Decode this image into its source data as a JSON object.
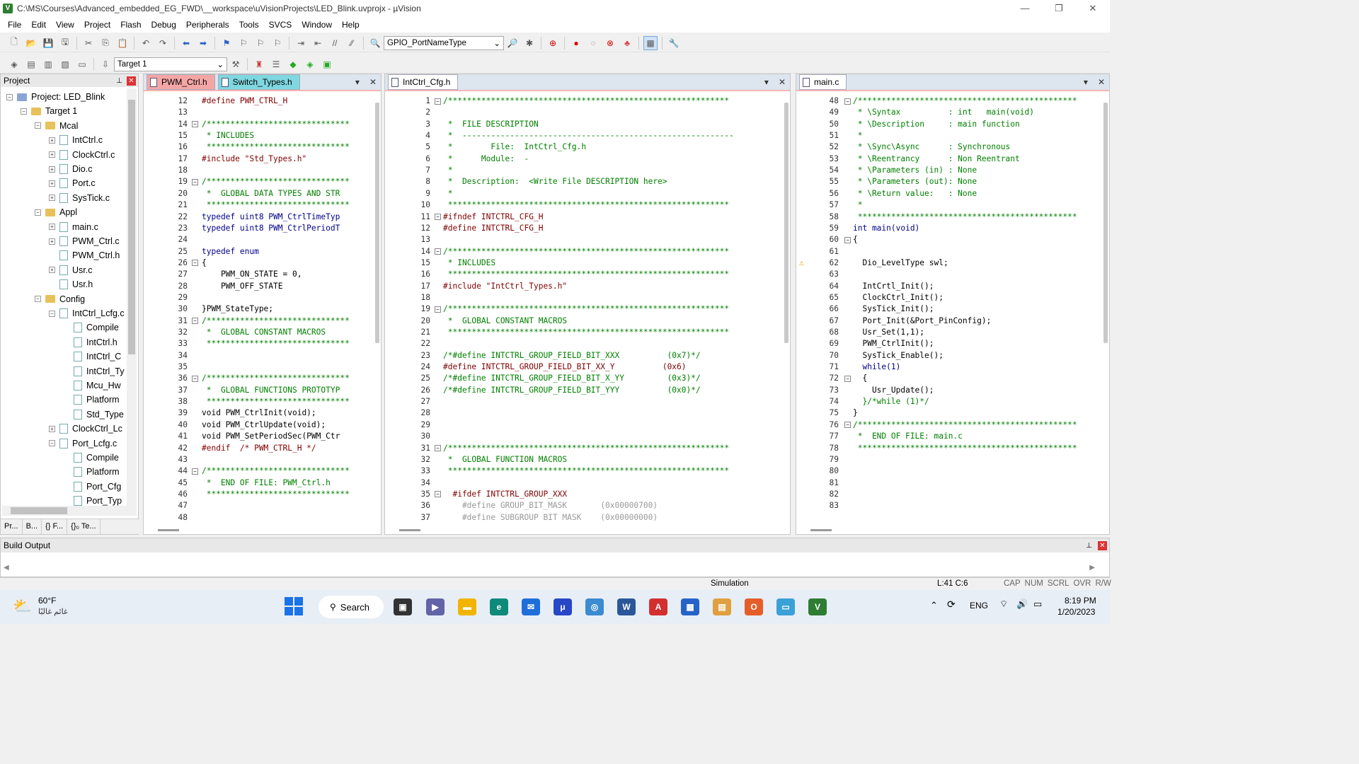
{
  "window": {
    "title": "C:\\MS\\Courses\\Advanced_embedded_EG_FWD\\__workspace\\uVisionProjects\\LED_Blink.uvprojx - µVision",
    "minimize": "—",
    "maximize": "❐",
    "close": "✕"
  },
  "menu": [
    "File",
    "Edit",
    "View",
    "Project",
    "Flash",
    "Debug",
    "Peripherals",
    "Tools",
    "SVCS",
    "Window",
    "Help"
  ],
  "toolbar1": {
    "type_combo": "GPIO_PortNameType"
  },
  "toolbar2": {
    "target_combo": "Target 1"
  },
  "project_panel": {
    "title": "Project",
    "tree": [
      {
        "label": "Project: LED_Blink",
        "level": 0,
        "kind": "project",
        "exp": "−"
      },
      {
        "label": "Target 1",
        "level": 1,
        "kind": "folder",
        "exp": "−"
      },
      {
        "label": "Mcal",
        "level": 2,
        "kind": "folder",
        "exp": "−"
      },
      {
        "label": "IntCtrl.c",
        "level": 3,
        "kind": "file",
        "exp": "+"
      },
      {
        "label": "ClockCtrl.c",
        "level": 3,
        "kind": "file",
        "exp": "+"
      },
      {
        "label": "Dio.c",
        "level": 3,
        "kind": "file",
        "exp": "+"
      },
      {
        "label": "Port.c",
        "level": 3,
        "kind": "file",
        "exp": "+"
      },
      {
        "label": "SysTick.c",
        "level": 3,
        "kind": "file",
        "exp": "+"
      },
      {
        "label": "Appl",
        "level": 2,
        "kind": "folder",
        "exp": "−"
      },
      {
        "label": "main.c",
        "level": 3,
        "kind": "file",
        "exp": "+"
      },
      {
        "label": "PWM_Ctrl.c",
        "level": 3,
        "kind": "file",
        "exp": "+"
      },
      {
        "label": "PWM_Ctrl.h",
        "level": 3,
        "kind": "file",
        "exp": ""
      },
      {
        "label": "Usr.c",
        "level": 3,
        "kind": "file",
        "exp": "+"
      },
      {
        "label": "Usr.h",
        "level": 3,
        "kind": "file",
        "exp": ""
      },
      {
        "label": "Config",
        "level": 2,
        "kind": "folder",
        "exp": "−"
      },
      {
        "label": "IntCtrl_Lcfg.c",
        "level": 3,
        "kind": "file",
        "exp": "−"
      },
      {
        "label": "Compile",
        "level": 4,
        "kind": "file",
        "exp": ""
      },
      {
        "label": "IntCtrl.h",
        "level": 4,
        "kind": "file",
        "exp": ""
      },
      {
        "label": "IntCtrl_C",
        "level": 4,
        "kind": "file",
        "exp": ""
      },
      {
        "label": "IntCtrl_Ty",
        "level": 4,
        "kind": "file",
        "exp": ""
      },
      {
        "label": "Mcu_Hw",
        "level": 4,
        "kind": "file",
        "exp": ""
      },
      {
        "label": "Platform",
        "level": 4,
        "kind": "file",
        "exp": ""
      },
      {
        "label": "Std_Type",
        "level": 4,
        "kind": "file",
        "exp": ""
      },
      {
        "label": "ClockCtrl_Lc",
        "level": 3,
        "kind": "file",
        "exp": "+"
      },
      {
        "label": "Port_Lcfg.c",
        "level": 3,
        "kind": "file",
        "exp": "−"
      },
      {
        "label": "Compile",
        "level": 4,
        "kind": "file",
        "exp": ""
      },
      {
        "label": "Platform",
        "level": 4,
        "kind": "file",
        "exp": ""
      },
      {
        "label": "Port_Cfg",
        "level": 4,
        "kind": "file",
        "exp": ""
      },
      {
        "label": "Port_Typ",
        "level": 4,
        "kind": "file",
        "exp": ""
      }
    ],
    "bottom_tabs": [
      "Pr...",
      "B...",
      "{} F...",
      "{}₀ Te..."
    ]
  },
  "editor1": {
    "tabs": [
      {
        "label": "PWM_Ctrl.h",
        "active": true
      },
      {
        "label": "Switch_Types.h",
        "active": false
      }
    ],
    "lines": [
      {
        "n": "12",
        "t": "#define PWM_CTRL_H",
        "c": "pp",
        "f": ""
      },
      {
        "n": "13",
        "t": "",
        "c": "",
        "f": ""
      },
      {
        "n": "14",
        "t": "/******************************",
        "c": "cmt",
        "f": "−"
      },
      {
        "n": "15",
        "t": " * INCLUDES",
        "c": "cmt",
        "f": ""
      },
      {
        "n": "16",
        "t": " ******************************",
        "c": "cmt",
        "f": ""
      },
      {
        "n": "17",
        "t": "#include \"Std_Types.h\"",
        "c": "pp",
        "f": ""
      },
      {
        "n": "18",
        "t": "",
        "c": "",
        "f": ""
      },
      {
        "n": "19",
        "t": "/******************************",
        "c": "cmt",
        "f": "−"
      },
      {
        "n": "20",
        "t": " *  GLOBAL DATA TYPES AND STR",
        "c": "cmt",
        "f": ""
      },
      {
        "n": "21",
        "t": " ******************************",
        "c": "cmt",
        "f": ""
      },
      {
        "n": "22",
        "t": "typedef uint8 PWM_CtrlTimeTyp",
        "c": "kw",
        "f": ""
      },
      {
        "n": "23",
        "t": "typedef uint8 PWM_CtrlPeriodT",
        "c": "kw",
        "f": ""
      },
      {
        "n": "24",
        "t": "",
        "c": "",
        "f": ""
      },
      {
        "n": "25",
        "t": "typedef enum",
        "c": "kw",
        "f": ""
      },
      {
        "n": "26",
        "t": "{",
        "c": "",
        "f": "−"
      },
      {
        "n": "27",
        "t": "    PWM_ON_STATE = 0,",
        "c": "",
        "f": ""
      },
      {
        "n": "28",
        "t": "    PWM_OFF_STATE",
        "c": "",
        "f": ""
      },
      {
        "n": "29",
        "t": "",
        "c": "",
        "f": ""
      },
      {
        "n": "30",
        "t": "}PWM_StateType;",
        "c": "",
        "f": ""
      },
      {
        "n": "31",
        "t": "/******************************",
        "c": "cmt",
        "f": "−"
      },
      {
        "n": "32",
        "t": " *  GLOBAL CONSTANT MACROS",
        "c": "cmt",
        "f": ""
      },
      {
        "n": "33",
        "t": " ******************************",
        "c": "cmt",
        "f": ""
      },
      {
        "n": "34",
        "t": "",
        "c": "",
        "f": ""
      },
      {
        "n": "35",
        "t": "",
        "c": "",
        "f": ""
      },
      {
        "n": "36",
        "t": "/******************************",
        "c": "cmt",
        "f": "−"
      },
      {
        "n": "37",
        "t": " *  GLOBAL FUNCTIONS PROTOTYP",
        "c": "cmt",
        "f": ""
      },
      {
        "n": "38",
        "t": " ******************************",
        "c": "cmt",
        "f": ""
      },
      {
        "n": "39",
        "t": "void PWM_CtrlInit(void);",
        "c": "",
        "f": ""
      },
      {
        "n": "40",
        "t": "void PWM_CtrlUpdate(void);",
        "c": "",
        "f": ""
      },
      {
        "n": "41",
        "t": "void PWM_SetPeriodSec(PWM_Ctr",
        "c": "",
        "f": ""
      },
      {
        "n": "42",
        "t": "#endif  /* PWM_CTRL_H */",
        "c": "pp",
        "f": ""
      },
      {
        "n": "43",
        "t": "",
        "c": "",
        "f": ""
      },
      {
        "n": "44",
        "t": "/******************************",
        "c": "cmt",
        "f": "−"
      },
      {
        "n": "45",
        "t": " *  END OF FILE: PWM_Ctrl.h",
        "c": "cmt",
        "f": ""
      },
      {
        "n": "46",
        "t": " ******************************",
        "c": "cmt",
        "f": ""
      },
      {
        "n": "47",
        "t": "",
        "c": "",
        "f": ""
      },
      {
        "n": "48",
        "t": "",
        "c": "",
        "f": ""
      }
    ]
  },
  "editor2": {
    "tabs": [
      {
        "label": "IntCtrl_Cfg.h",
        "active": true
      }
    ],
    "lines": [
      {
        "n": "1",
        "t": "/***********************************************************",
        "c": "cmt",
        "f": "−"
      },
      {
        "n": "2",
        "t": "",
        "c": "",
        "f": ""
      },
      {
        "n": "3",
        "t": " *  FILE DESCRIPTION",
        "c": "cmt",
        "f": ""
      },
      {
        "n": "4",
        "t": " *  ---------------------------------------------------------",
        "c": "cmt",
        "f": ""
      },
      {
        "n": "5",
        "t": " *        File:  IntCtrl_Cfg.h",
        "c": "cmt",
        "f": ""
      },
      {
        "n": "6",
        "t": " *      Module:  -",
        "c": "cmt",
        "f": ""
      },
      {
        "n": "7",
        "t": " *",
        "c": "cmt",
        "f": ""
      },
      {
        "n": "8",
        "t": " *  Description:  <Write File DESCRIPTION here>",
        "c": "cmt",
        "f": ""
      },
      {
        "n": "9",
        "t": " *",
        "c": "cmt",
        "f": ""
      },
      {
        "n": "10",
        "t": " ***********************************************************",
        "c": "cmt",
        "f": ""
      },
      {
        "n": "11",
        "t": "#ifndef INTCTRL_CFG_H",
        "c": "pp",
        "f": "−"
      },
      {
        "n": "12",
        "t": "#define INTCTRL_CFG_H",
        "c": "pp",
        "f": ""
      },
      {
        "n": "13",
        "t": "",
        "c": "",
        "f": ""
      },
      {
        "n": "14",
        "t": "/***********************************************************",
        "c": "cmt",
        "f": "−"
      },
      {
        "n": "15",
        "t": " * INCLUDES",
        "c": "cmt",
        "f": ""
      },
      {
        "n": "16",
        "t": " ***********************************************************",
        "c": "cmt",
        "f": ""
      },
      {
        "n": "17",
        "t": "#include \"IntCtrl_Types.h\"",
        "c": "pp",
        "f": ""
      },
      {
        "n": "18",
        "t": "",
        "c": "",
        "f": ""
      },
      {
        "n": "19",
        "t": "/***********************************************************",
        "c": "cmt",
        "f": "−"
      },
      {
        "n": "20",
        "t": " *  GLOBAL CONSTANT MACROS",
        "c": "cmt",
        "f": ""
      },
      {
        "n": "21",
        "t": " ***********************************************************",
        "c": "cmt",
        "f": ""
      },
      {
        "n": "22",
        "t": "",
        "c": "",
        "f": ""
      },
      {
        "n": "23",
        "t": "/*#define INTCTRL_GROUP_FIELD_BIT_XXX          (0x7)*/",
        "c": "cmt",
        "f": ""
      },
      {
        "n": "24",
        "t": "#define INTCTRL_GROUP_FIELD_BIT_XX_Y          (0x6)",
        "c": "pp",
        "f": ""
      },
      {
        "n": "25",
        "t": "/*#define INTCTRL_GROUP_FIELD_BIT_X_YY         (0x3)*/",
        "c": "cmt",
        "f": ""
      },
      {
        "n": "26",
        "t": "/*#define INTCTRL_GROUP_FIELD_BIT_YYY          (0x0)*/",
        "c": "cmt",
        "f": ""
      },
      {
        "n": "27",
        "t": "",
        "c": "",
        "f": ""
      },
      {
        "n": "28",
        "t": "",
        "c": "",
        "f": ""
      },
      {
        "n": "29",
        "t": "",
        "c": "",
        "f": ""
      },
      {
        "n": "30",
        "t": "",
        "c": "",
        "f": ""
      },
      {
        "n": "31",
        "t": "/***********************************************************",
        "c": "cmt",
        "f": "−"
      },
      {
        "n": "32",
        "t": " *  GLOBAL FUNCTION MACROS",
        "c": "cmt",
        "f": ""
      },
      {
        "n": "33",
        "t": " ***********************************************************",
        "c": "cmt",
        "f": ""
      },
      {
        "n": "34",
        "t": "",
        "c": "",
        "f": ""
      },
      {
        "n": "35",
        "t": "  #ifdef INTCTRL_GROUP_XXX",
        "c": "pp",
        "f": "−"
      },
      {
        "n": "36",
        "t": "    #define GROUP_BIT_MASK       (0x00000700)",
        "c": "grey",
        "f": ""
      },
      {
        "n": "37",
        "t": "    #define SUBGROUP_BIT_MASK    (0x00000000)",
        "c": "grey",
        "f": ""
      }
    ]
  },
  "editor3": {
    "tabs": [
      {
        "label": "main.c",
        "active": true
      }
    ],
    "lines": [
      {
        "n": "48",
        "t": "/**********************************************",
        "c": "cmt",
        "f": "−"
      },
      {
        "n": "49",
        "t": " * \\Syntax          : int   main(void)",
        "c": "cmt",
        "f": ""
      },
      {
        "n": "50",
        "t": " * \\Description     : main function",
        "c": "cmt",
        "f": ""
      },
      {
        "n": "51",
        "t": " *",
        "c": "cmt",
        "f": ""
      },
      {
        "n": "52",
        "t": " * \\Sync\\Async      : Synchronous",
        "c": "cmt",
        "f": ""
      },
      {
        "n": "53",
        "t": " * \\Reentrancy      : Non Reentrant",
        "c": "cmt",
        "f": ""
      },
      {
        "n": "54",
        "t": " * \\Parameters (in) : None",
        "c": "cmt",
        "f": ""
      },
      {
        "n": "55",
        "t": " * \\Parameters (out): None",
        "c": "cmt",
        "f": ""
      },
      {
        "n": "56",
        "t": " * \\Return value:   : None",
        "c": "cmt",
        "f": ""
      },
      {
        "n": "57",
        "t": " *",
        "c": "cmt",
        "f": ""
      },
      {
        "n": "58",
        "t": " **********************************************",
        "c": "cmt",
        "f": ""
      },
      {
        "n": "59",
        "t": "int main(void)",
        "c": "kw",
        "f": ""
      },
      {
        "n": "60",
        "t": "{",
        "c": "",
        "f": "−"
      },
      {
        "n": "61",
        "t": "",
        "c": "",
        "f": ""
      },
      {
        "n": "62",
        "t": "  Dio_LevelType swl;",
        "c": "",
        "f": ""
      },
      {
        "n": "63",
        "t": "",
        "c": "",
        "f": ""
      },
      {
        "n": "64",
        "t": "  IntCrtl_Init();",
        "c": "",
        "f": ""
      },
      {
        "n": "65",
        "t": "  ClockCtrl_Init();",
        "c": "",
        "f": ""
      },
      {
        "n": "66",
        "t": "  SysTick_Init();",
        "c": "",
        "f": ""
      },
      {
        "n": "67",
        "t": "  Port_Init(&Port_PinConfig);",
        "c": "",
        "f": ""
      },
      {
        "n": "68",
        "t": "  Usr_Set(1,1);",
        "c": "",
        "f": ""
      },
      {
        "n": "69",
        "t": "  PWM_CtrlInit();",
        "c": "",
        "f": ""
      },
      {
        "n": "70",
        "t": "  SysTick_Enable();",
        "c": "",
        "f": ""
      },
      {
        "n": "71",
        "t": "  while(1)",
        "c": "kw",
        "f": ""
      },
      {
        "n": "72",
        "t": "  {",
        "c": "",
        "f": "−"
      },
      {
        "n": "73",
        "t": "    Usr_Update();",
        "c": "",
        "f": ""
      },
      {
        "n": "74",
        "t": "  }/*while (1)*/",
        "c": "cmt",
        "f": ""
      },
      {
        "n": "75",
        "t": "}",
        "c": "",
        "f": ""
      },
      {
        "n": "76",
        "t": "/**********************************************",
        "c": "cmt",
        "f": "−"
      },
      {
        "n": "77",
        "t": " *  END OF FILE: main.c",
        "c": "cmt",
        "f": ""
      },
      {
        "n": "78",
        "t": " **********************************************",
        "c": "cmt",
        "f": ""
      },
      {
        "n": "79",
        "t": "",
        "c": "",
        "f": ""
      },
      {
        "n": "80",
        "t": "",
        "c": "",
        "f": ""
      },
      {
        "n": "81",
        "t": "",
        "c": "",
        "f": ""
      },
      {
        "n": "82",
        "t": "",
        "c": "",
        "f": ""
      },
      {
        "n": "83",
        "t": "",
        "c": "",
        "f": ""
      }
    ],
    "warning_line": "62"
  },
  "build_output": {
    "title": "Build Output"
  },
  "status": {
    "mode": "Simulation",
    "position": "L:41 C:6",
    "flags": [
      "CAP",
      "NUM",
      "SCRL",
      "OVR",
      "R/W"
    ]
  },
  "taskbar": {
    "weather_temp": "60°F",
    "weather_desc": "غائم غالبًا",
    "search": "Search",
    "lang": "ENG",
    "time": "8:19 PM",
    "date": "1/20/2023"
  },
  "colors": {
    "comment": "#008000",
    "keyword": "#00008b",
    "preprocessor": "#800000",
    "active_tab": "#f4a6a6",
    "inactive_tab": "#7fd7e0"
  }
}
